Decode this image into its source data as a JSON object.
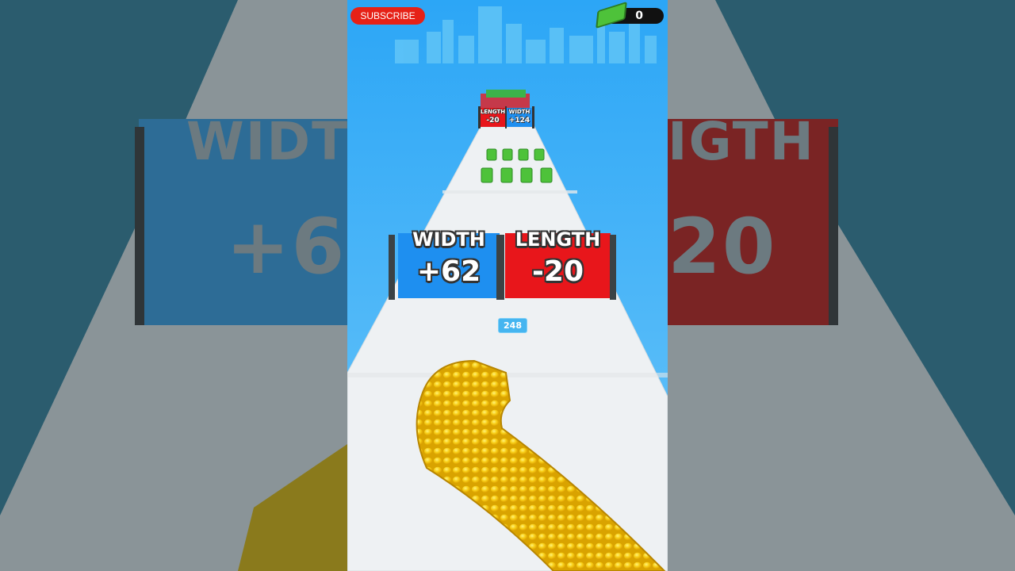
{
  "header": {
    "subscribe_label": "SUBSCRIBE",
    "money_count": "0"
  },
  "gates": {
    "near": [
      {
        "label": "WIDTH",
        "value": "+62",
        "color": "#1e8ff0"
      },
      {
        "label": "LENGTH",
        "value": "-20",
        "color": "#e8161b"
      }
    ],
    "far": [
      {
        "label": "LENGTH",
        "value": "-20",
        "color": "#e8161b"
      },
      {
        "label": "WIDTH",
        "value": "+124",
        "color": "#1e8ff0"
      }
    ]
  },
  "crowd_count": "248",
  "background_blur": {
    "left_label": "WIDT",
    "left_value": "+6",
    "right_label": "IGTH",
    "right_value": "20"
  },
  "colors": {
    "sky": "#3fb1f7",
    "road": "#f2f4f5",
    "coin": "#f5c30c",
    "cash": "#4ec23a"
  }
}
